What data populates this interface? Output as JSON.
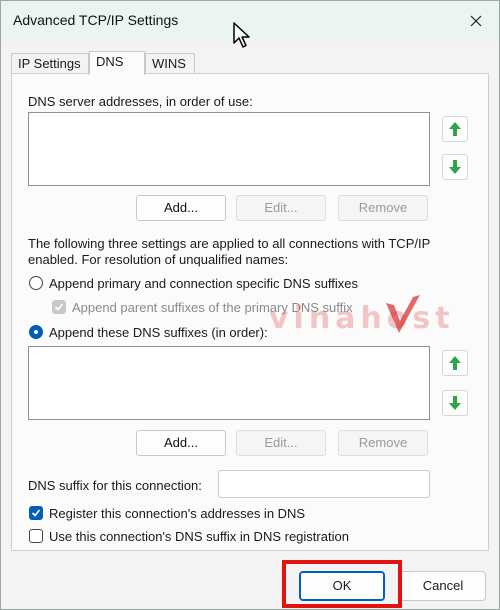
{
  "window": {
    "title": "Advanced TCP/IP Settings"
  },
  "tabs": [
    {
      "label": "IP Settings",
      "active": false
    },
    {
      "label": "DNS",
      "active": true
    },
    {
      "label": "WINS",
      "active": false
    }
  ],
  "dns": {
    "servers_label": "DNS server addresses, in order of use:",
    "servers": [],
    "add_label": "Add...",
    "edit_label": "Edit...",
    "remove_label": "Remove",
    "resolution_text_line1": "The following three settings are applied to all connections with TCP/IP",
    "resolution_text_line2": "enabled. For resolution of unqualified names:",
    "radio_primary_label": "Append primary and connection specific DNS suffixes",
    "checkbox_parent_label": "Append parent suffixes of the primary DNS suffix",
    "radio_these_label": "Append these DNS suffixes (in order):",
    "suffixes": [],
    "suffix_label": "DNS suffix for this connection:",
    "suffix_value": "",
    "register_label": "Register this connection's addresses in DNS",
    "use_suffix_label": "Use this connection's DNS suffix in DNS registration",
    "radio_selected": "these",
    "register_checked": true,
    "use_suffix_checked": false,
    "parent_checked": true
  },
  "footer": {
    "ok_label": "OK",
    "cancel_label": "Cancel"
  },
  "watermark": {
    "text": "vinahost"
  },
  "colors": {
    "accent": "#005fb8",
    "arrow_green": "#2fa34a",
    "highlight": "#e01313"
  }
}
